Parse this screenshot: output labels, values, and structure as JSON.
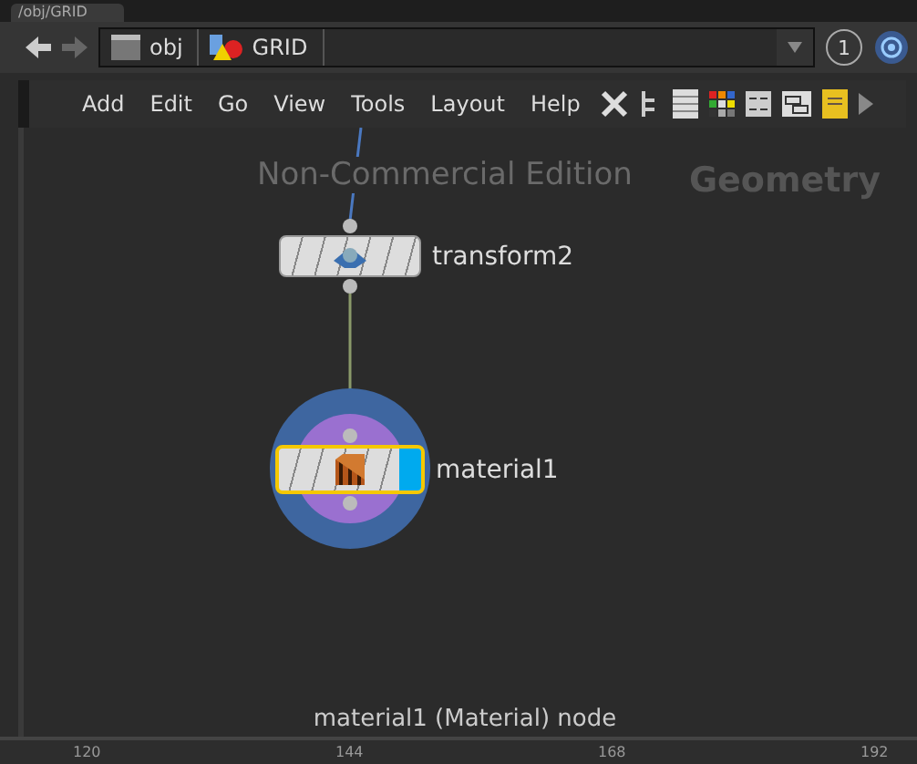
{
  "tab": {
    "title": "/obj/GRID"
  },
  "path": {
    "crumbs": [
      {
        "label": "obj",
        "kind": "obj"
      },
      {
        "label": "GRID",
        "kind": "geo"
      }
    ],
    "pin": "1"
  },
  "menu": [
    "Add",
    "Edit",
    "Go",
    "View",
    "Tools",
    "Layout",
    "Help"
  ],
  "network": {
    "edition": "Non-Commercial Edition",
    "context": "Geometry",
    "status": "material1 (Material) node",
    "nodes": [
      {
        "name": "transform2",
        "kind": "transform",
        "selected": false
      },
      {
        "name": "material1",
        "kind": "material",
        "selected": true
      }
    ]
  },
  "ruler": [
    "120",
    "144",
    "168",
    "192"
  ]
}
